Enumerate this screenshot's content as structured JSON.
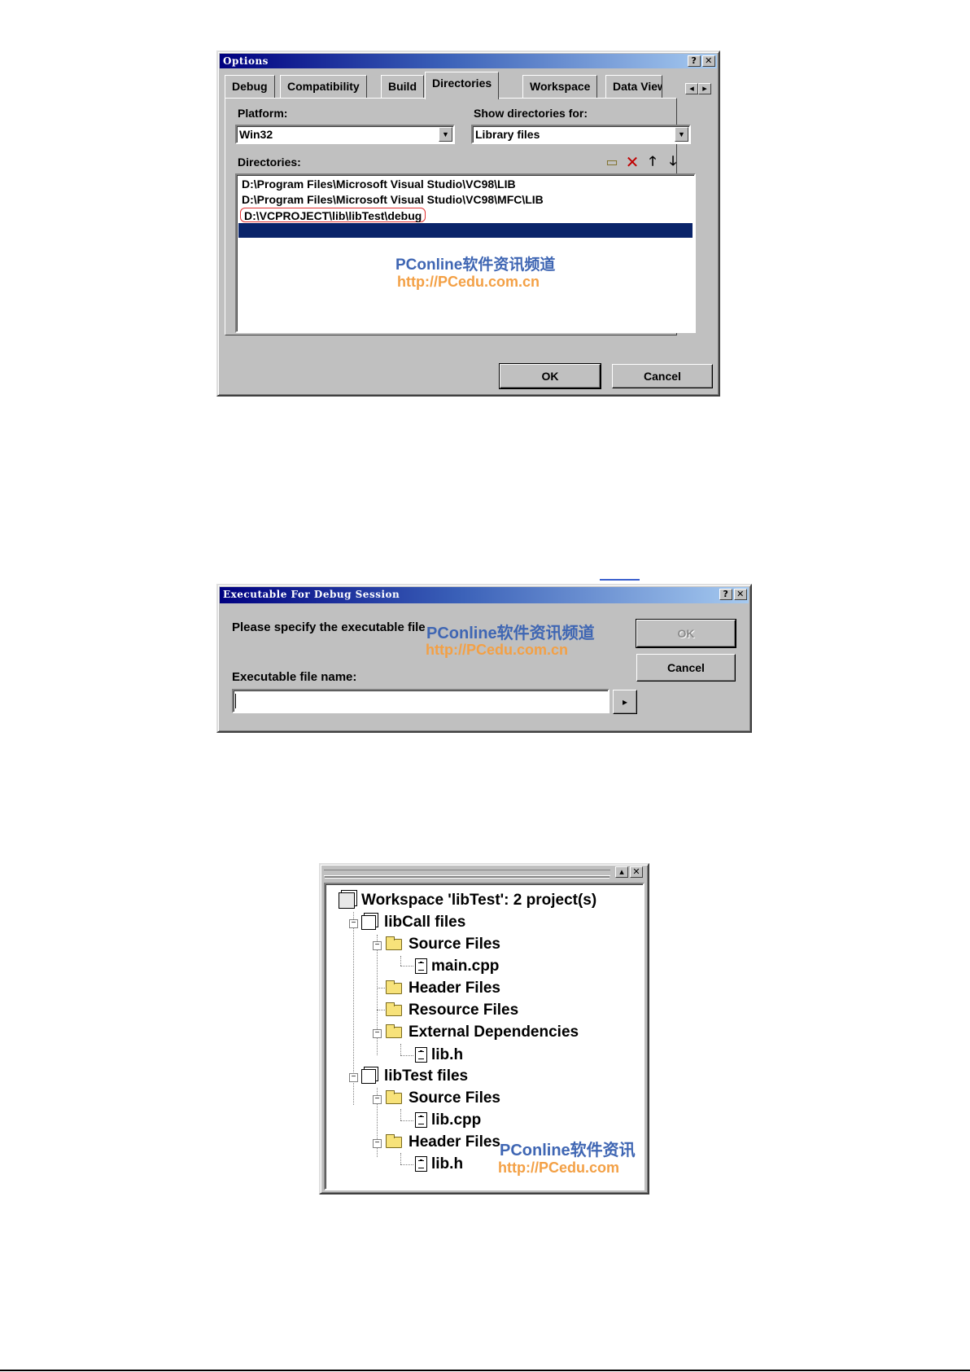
{
  "options_dialog": {
    "title": "Options",
    "help_btn": "?",
    "close_btn": "✕",
    "tabs": [
      "Debug",
      "Compatibility",
      "Build",
      "Directories",
      "Workspace",
      "Data View"
    ],
    "active_tab": "Directories",
    "tab_scroll_left": "◂",
    "tab_scroll_right": "▸",
    "platform_label": "Platform:",
    "platform_value": "Win32",
    "show_dirs_label": "Show directories for:",
    "show_dirs_value": "Library files",
    "directories_label": "Directories:",
    "toolbar_icons": [
      "new-folder-icon",
      "delete-icon",
      "move-up-icon",
      "move-down-icon"
    ],
    "directories": [
      "D:\\Program Files\\Microsoft Visual Studio\\VC98\\LIB",
      "D:\\Program Files\\Microsoft Visual Studio\\VC98\\MFC\\LIB",
      "D:\\VCPROJECT\\lib\\libTest\\debug"
    ],
    "watermark_line1": "PConline软件资讯频道",
    "watermark_line2": "http://PCedu.com.cn",
    "ok_label": "OK",
    "cancel_label": "Cancel"
  },
  "debug_dialog": {
    "title": "Executable For Debug Session",
    "help_btn": "?",
    "close_btn": "✕",
    "prompt": "Please specify the executable file.",
    "exe_label": "Executable file name:",
    "exe_value": "",
    "browse_btn": "▸",
    "ok_label": "OK",
    "cancel_label": "Cancel",
    "watermark_line1": "PConline软件资讯频道",
    "watermark_line2": "http://PCedu.com.cn"
  },
  "workspace_panel": {
    "min_btn": "▴",
    "close_btn": "✕",
    "watermark_line1": "PConline软件资讯",
    "watermark_line2": "http://PCedu.com",
    "tree": {
      "root": "Workspace 'libTest': 2 project(s)",
      "p1": "libCall files",
      "p1_src": "Source Files",
      "p1_src_f1": "main.cpp",
      "p1_hdr": "Header Files",
      "p1_res": "Resource Files",
      "p1_ext": "External Dependencies",
      "p1_ext_f1": "lib.h",
      "p2": "libTest files",
      "p2_src": "Source Files",
      "p2_src_f1": "lib.cpp",
      "p2_hdr": "Header Files",
      "p2_hdr_f1": "lib.h"
    }
  }
}
